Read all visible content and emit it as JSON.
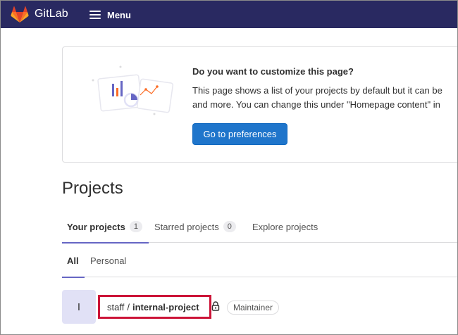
{
  "navbar": {
    "brand": "GitLab",
    "menu_label": "Menu",
    "logo_icon": "gitlab-tanuki-icon",
    "menu_icon": "hamburger-icon",
    "colors": {
      "background": "#292961",
      "logo": "#e24329"
    }
  },
  "customize": {
    "title": "Do you want to customize this page?",
    "text_line1": "This page shows a list of your projects by default but it can be",
    "text_line2": "and more. You can change this under \"Homepage content\" in",
    "button": "Go to preferences",
    "illustration_icon": "customize-homepage-illustration",
    "button_color": "#1f75cb"
  },
  "page": {
    "title": "Projects"
  },
  "tabs": [
    {
      "label": "Your projects",
      "count": "1",
      "active": true
    },
    {
      "label": "Starred projects",
      "count": "0",
      "active": false
    },
    {
      "label": "Explore projects",
      "count": null,
      "active": false
    }
  ],
  "subtabs": [
    {
      "label": "All",
      "active": true
    },
    {
      "label": "Personal",
      "active": false
    }
  ],
  "project": {
    "avatar_letter": "I",
    "namespace": "staff",
    "separator": "/",
    "name": "internal-project",
    "visibility_icon": "lock-icon",
    "role": "Maintainer",
    "highlight_color": "#cc1438"
  }
}
